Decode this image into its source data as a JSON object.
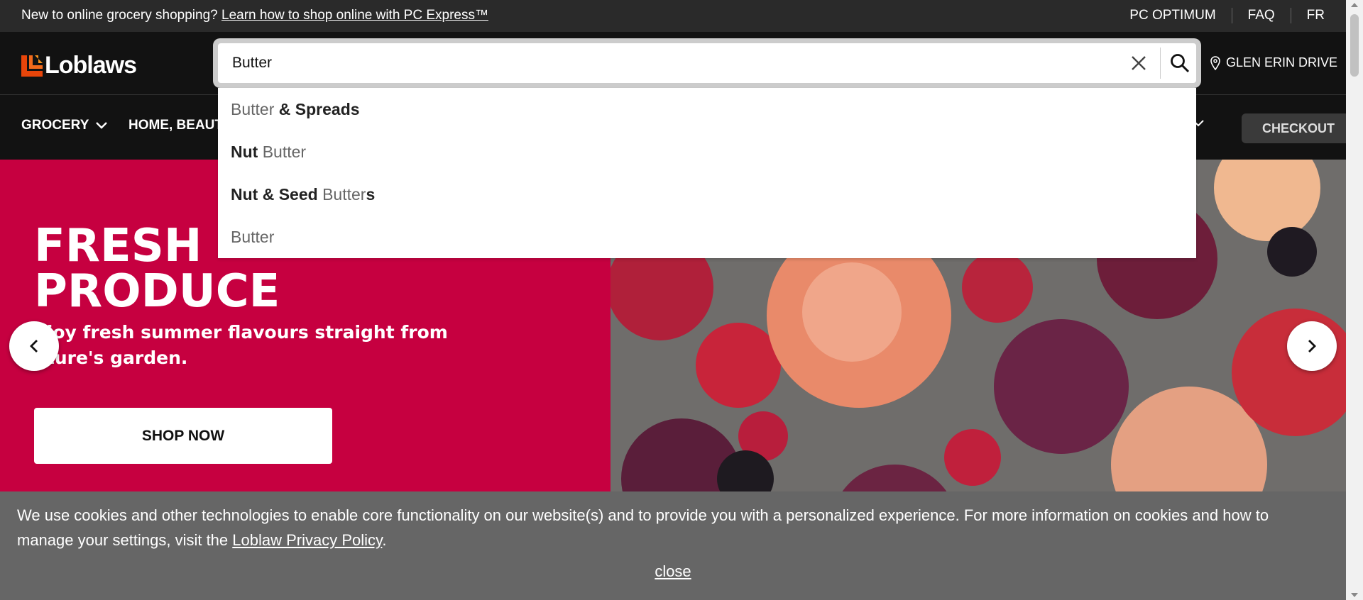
{
  "topbar": {
    "promo_text": "New to online grocery shopping? ",
    "promo_link": "Learn how to shop online with PC Express™",
    "links": [
      "PC OPTIMUM",
      "FAQ",
      "FR"
    ]
  },
  "header": {
    "logo_text": "Loblaws",
    "store_name": "GLEN ERIN DRIVE"
  },
  "search": {
    "value": "Butter",
    "suggestions": [
      {
        "muted_before": "",
        "bold_before": "",
        "muted": "Butter",
        "bold_after": " & Spreads"
      },
      {
        "muted_before": "",
        "bold_before": "Nut ",
        "muted": "Butter",
        "bold_after": ""
      },
      {
        "muted_before": "",
        "bold_before": "Nut & Seed ",
        "muted": "Butter",
        "bold_after": "s"
      },
      {
        "muted_before": "",
        "bold_before": "",
        "muted": "Butter",
        "bold_after": ""
      }
    ]
  },
  "nav": {
    "grocery": "GROCERY",
    "home_beauty": "HOME, BEAUT",
    "checkout": "CHECKOUT"
  },
  "hero": {
    "title_line1": "FRESH",
    "title_line2": "PRODUCE",
    "subtitle_line1": "njoy fresh summer flavours straight from",
    "subtitle_line2": "ature's garden.",
    "cta": "SHOP NOW"
  },
  "cookie": {
    "text": "We use cookies and other technologies to enable core functionality on our website(s) and to provide you with a personalized experience. For more information on cookies and how to manage your settings, visit the ",
    "link": "Loblaw Privacy Policy",
    "after": ".",
    "close": "close"
  },
  "colors": {
    "brand_red": "#c60040",
    "header_bg": "#121212",
    "topbar_bg": "#2a2a2a",
    "cookie_bg": "#666666"
  }
}
